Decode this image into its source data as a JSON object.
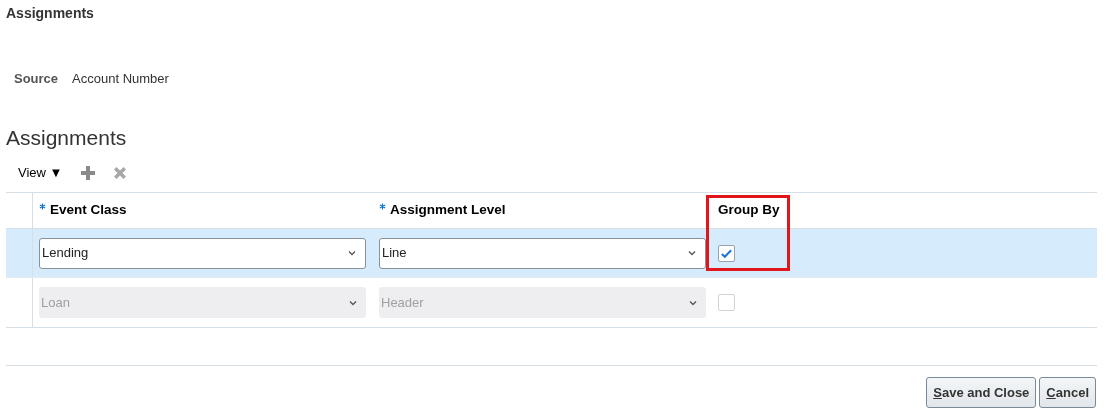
{
  "page_title": "Assignments",
  "source": {
    "label": "Source",
    "value": "Account Number"
  },
  "section_title": "Assignments",
  "toolbar": {
    "view_menu": "View ▼",
    "add_enabled": true,
    "delete_enabled": false
  },
  "table": {
    "columns": [
      {
        "label": "Event Class",
        "required": true,
        "highlighted": false
      },
      {
        "label": "Assignment Level",
        "required": true,
        "highlighted": false
      },
      {
        "label": "Group By",
        "required": false,
        "highlighted": true
      }
    ],
    "rows": [
      {
        "selected": true,
        "disabled": false,
        "event_class": "Lending",
        "assignment_level": "Line",
        "group_by_checked": true
      },
      {
        "selected": false,
        "disabled": true,
        "event_class": "Loan",
        "assignment_level": "Header",
        "group_by_checked": false
      }
    ]
  },
  "buttons": [
    {
      "label": "Save and Close",
      "underline_first": true
    },
    {
      "label": "Cancel",
      "underline_first": true
    }
  ]
}
